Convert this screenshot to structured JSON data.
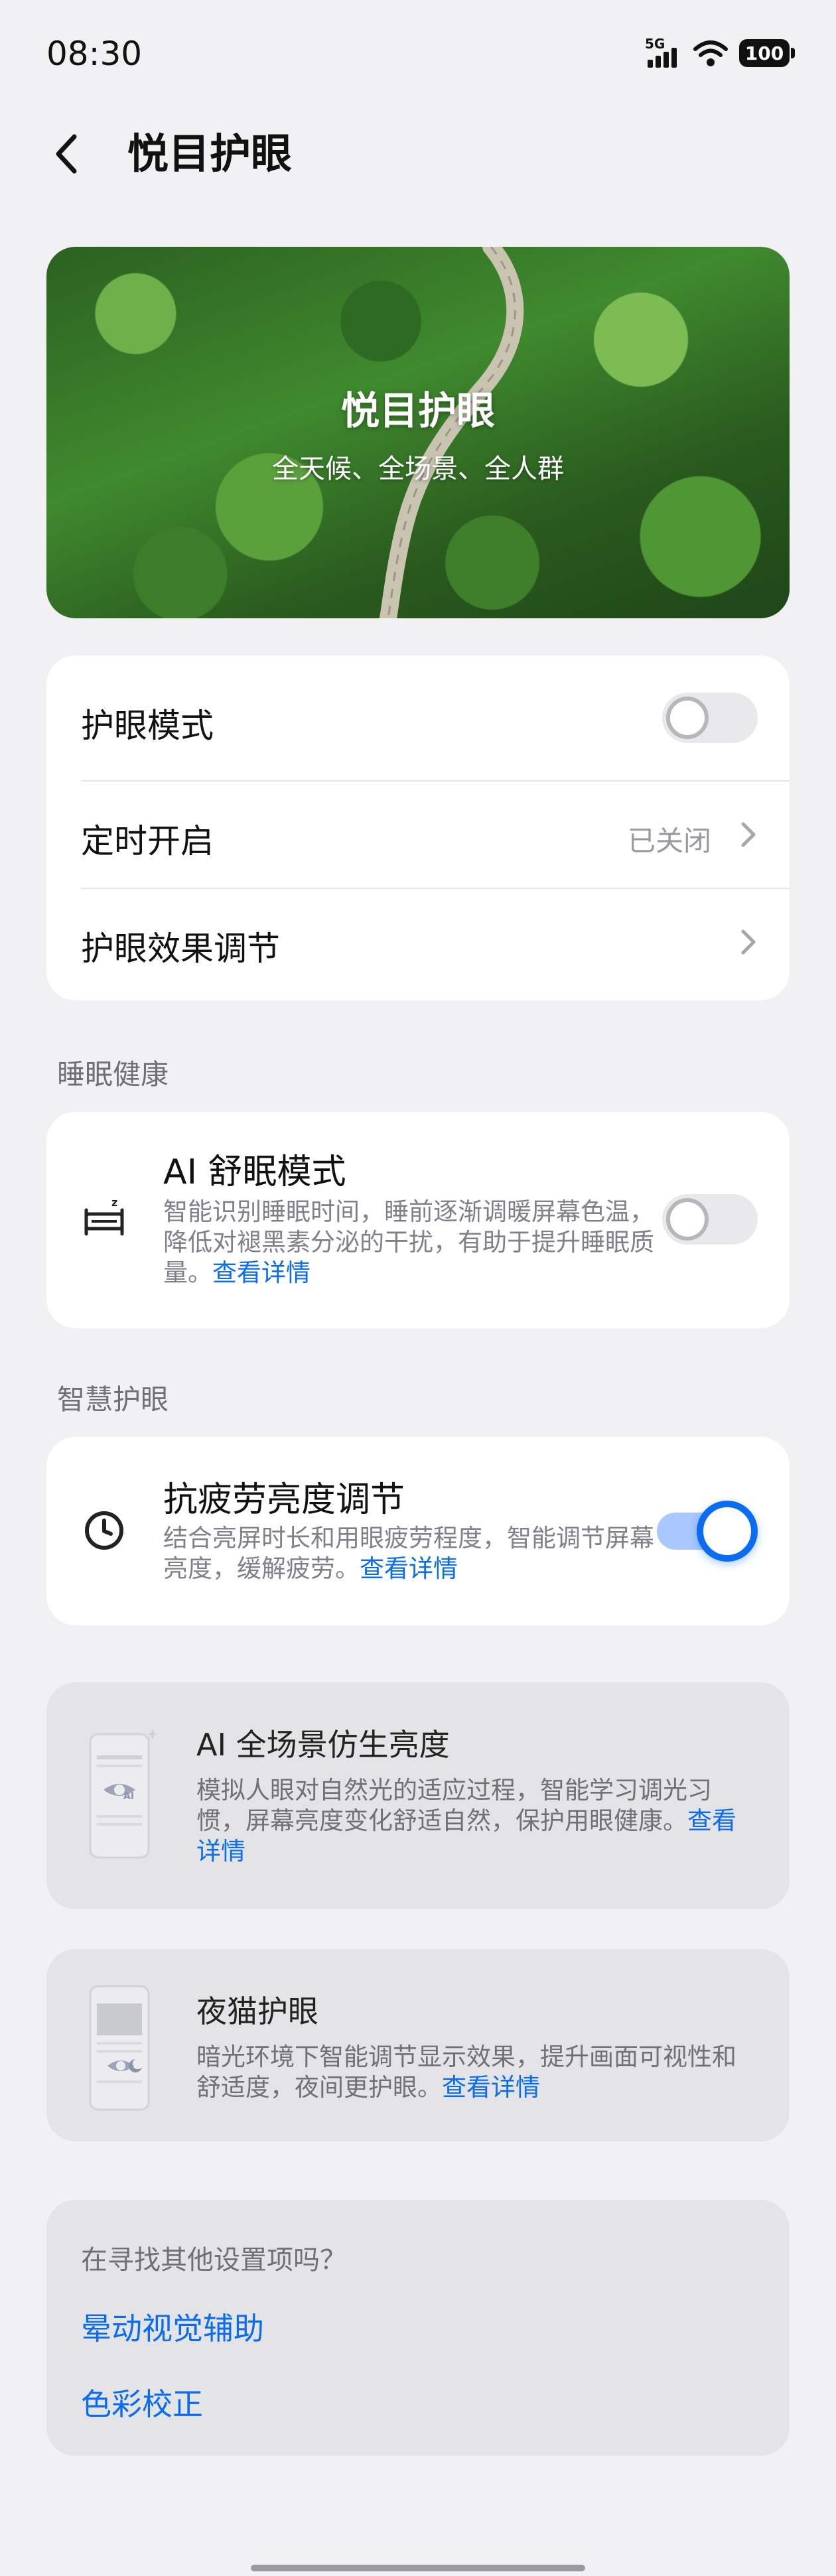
{
  "status_bar": {
    "time": "08:30",
    "network": "5G",
    "battery": "100"
  },
  "header": {
    "title": "悦目护眼"
  },
  "hero": {
    "title": "悦目护眼",
    "subtitle": "全天候、全场景、全人群"
  },
  "main_settings": {
    "eye_mode_label": "护眼模式",
    "eye_mode_on": false,
    "schedule_label": "定时开启",
    "schedule_value": "已关闭",
    "effect_label": "护眼效果调节"
  },
  "sleep_section": {
    "heading": "睡眠健康",
    "title": "AI 舒眠模式",
    "description": "智能识别睡眠时间，睡前逐渐调暖屏幕色温，降低对褪黑素分泌的干扰，有助于提升睡眠质量。",
    "link": "查看详情",
    "enabled": false
  },
  "smart_section": {
    "heading": "智慧护眼",
    "title": "抗疲劳亮度调节",
    "description": "结合亮屏时长和用眼疲劳程度，智能调节屏幕亮度，缓解疲劳。",
    "link": "查看详情",
    "enabled": true
  },
  "ai_brightness": {
    "title": "AI 全场景仿生亮度",
    "description": "模拟人眼对自然光的适应过程，智能学习调光习惯，屏幕亮度变化舒适自然，保护用眼健康。",
    "link": "查看详情"
  },
  "night_owl": {
    "title": "夜猫护眼",
    "description": "暗光环境下智能调节显示效果，提升画面可视性和舒适度，夜间更护眼。",
    "link": "查看详情"
  },
  "other_settings": {
    "title": "在寻找其他设置项吗？",
    "links": [
      "晕动视觉辅助",
      "色彩校正"
    ]
  }
}
